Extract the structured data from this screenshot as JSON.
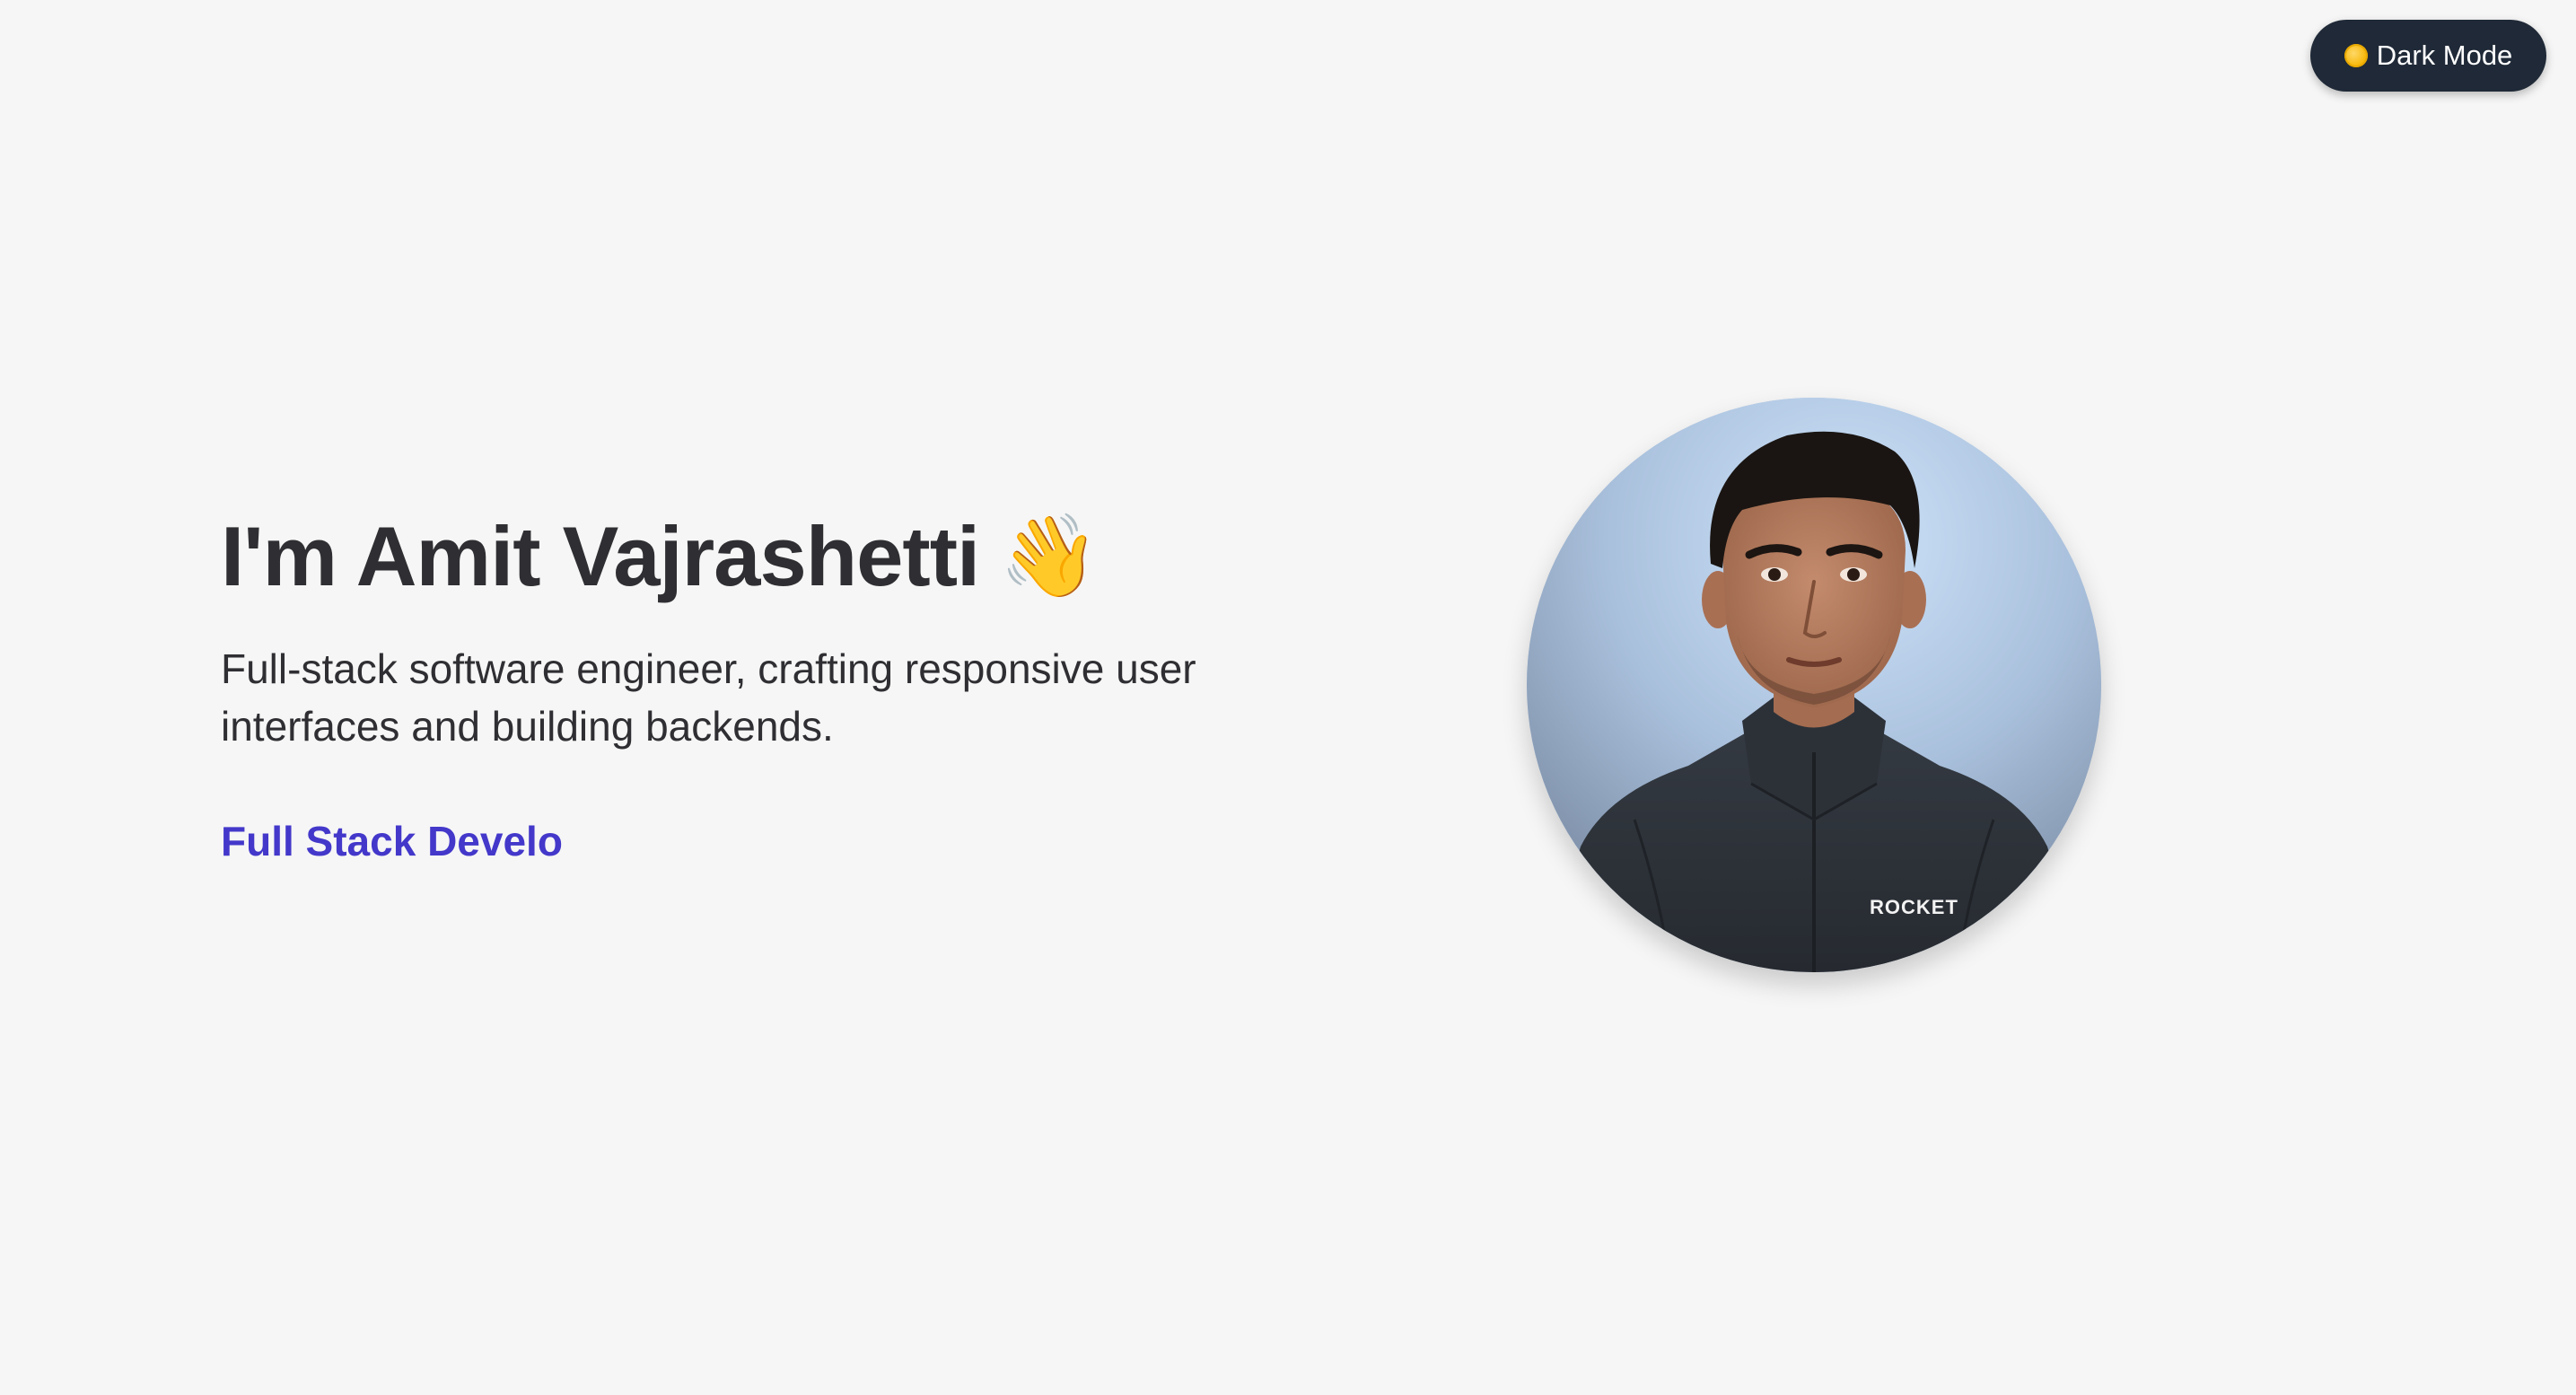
{
  "theme_toggle": {
    "label": "Dark Mode",
    "icon": "sun-icon"
  },
  "hero": {
    "title": "I'm Amit Vajrashetti",
    "wave_icon": "👋",
    "subtitle": "Full-stack software engineer, crafting responsive user interfaces and building backends.",
    "role": "Full Stack Develo"
  },
  "avatar": {
    "jacket_logo": "ROCKET",
    "colors": {
      "background_light": "#c5dcf6",
      "background_dark": "#8fa3bb",
      "jacket": "#2b3036",
      "skin": "#b98063",
      "hair": "#1a1512"
    }
  },
  "colors": {
    "page_background": "#f6f6f6",
    "text": "#2f2f33",
    "accent": "#4338ca",
    "toggle_background": "#1f2937"
  }
}
